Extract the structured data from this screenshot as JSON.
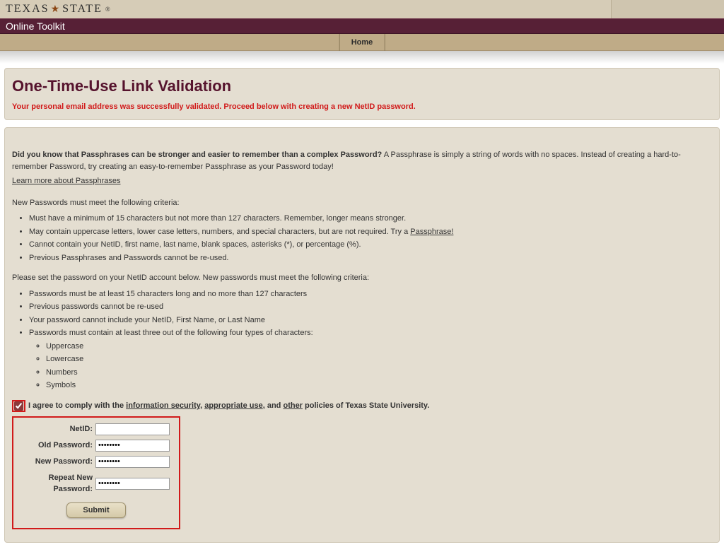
{
  "brand": {
    "text1": "TEXAS",
    "text2": "STATE"
  },
  "app_title": "Online Toolkit",
  "nav": {
    "home": "Home"
  },
  "header": {
    "title": "One-Time-Use Link Validation",
    "success": "Your personal email address was successfully validated. Proceed below with creating a new NetID password."
  },
  "passphrase": {
    "lead_bold": "Did you know that Passphrases can be stronger and easier to remember than a complex Password?",
    "lead_rest": " A Passphrase is simply a string of words with no spaces. Instead of creating a hard-to-remember Password, try creating an easy-to-remember Passphrase as your Password today!",
    "learn_link": "Learn more about Passphrases"
  },
  "criteria1": {
    "intro": "New Passwords must meet the following criteria:",
    "items": [
      "Must have a minimum of 15 characters but not more than 127 characters. Remember, longer means stronger.",
      "May contain uppercase letters, lower case letters, numbers, and special characters, but are not required. Try a ",
      "Cannot contain your NetID, first name, last name, blank spaces, asterisks (*), or percentage (%).",
      "Previous Passphrases and Passwords cannot be re-used."
    ],
    "passphrase_link": "Passphrase!"
  },
  "criteria2": {
    "intro": "Please set the password on your NetID account below. New passwords must meet the following criteria:",
    "items": [
      "Passwords must be at least 15 characters long and no more than 127 characters",
      "Previous passwords cannot be re-used",
      "Your password cannot include your NetID, First Name, or Last Name",
      "Passwords must contain at least three out of the following four types of characters:"
    ],
    "sub": [
      "Uppercase",
      "Lowercase",
      "Numbers",
      "Symbols"
    ]
  },
  "agree": {
    "pre": "I agree to comply with the ",
    "l1": "information security",
    "sep1": ", ",
    "l2": "appropriate use",
    "sep2": ", and ",
    "l3": "other",
    "post": " policies of Texas State University."
  },
  "form": {
    "netid_label": "NetID:",
    "old_label": "Old Password:",
    "new_label": "New Password:",
    "repeat_label": "Repeat New Password:",
    "netid_value": "",
    "old_value": "••••••••",
    "new_value": "••••••••",
    "repeat_value": "••••••••",
    "submit": "Submit"
  }
}
